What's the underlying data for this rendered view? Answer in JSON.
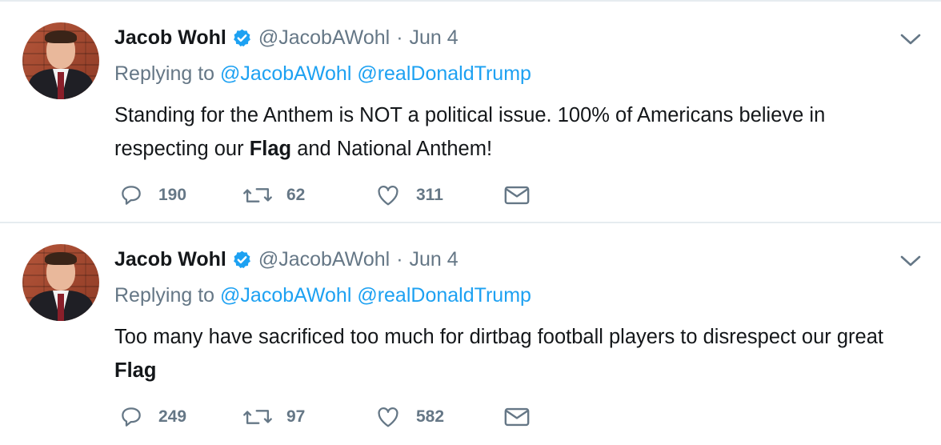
{
  "tweets": [
    {
      "name": "Jacob Wohl",
      "handle": "@JacobAWohl",
      "separator": "·",
      "date": "Jun 4",
      "replying_prefix": "Replying to",
      "replying_to": [
        "@JacobAWohl",
        "@realDonaldTrump"
      ],
      "text_before": "Standing for the Anthem is NOT a political issue. 100% of Americans believe in respecting our ",
      "text_bold": "Flag",
      "text_after": " and National Anthem!",
      "replies": "190",
      "retweets": "62",
      "likes": "311"
    },
    {
      "name": "Jacob Wohl",
      "handle": "@JacobAWohl",
      "separator": "·",
      "date": "Jun 4",
      "replying_prefix": "Replying to",
      "replying_to": [
        "@JacobAWohl",
        "@realDonaldTrump"
      ],
      "text_before": "Too many have sacrificed too much for dirtbag football players to disrespect our great ",
      "text_bold": "Flag",
      "text_after": "",
      "replies": "249",
      "retweets": "97",
      "likes": "582"
    }
  ],
  "icons": {
    "verified": "verified-badge-icon",
    "menu": "chevron-down-icon",
    "reply": "reply-bubble-icon",
    "retweet": "retweet-icon",
    "like": "heart-icon",
    "dm": "envelope-icon"
  },
  "colors": {
    "link": "#1da1f2",
    "muted": "#657786",
    "text": "#14171a",
    "separator": "#e6ecf0"
  }
}
